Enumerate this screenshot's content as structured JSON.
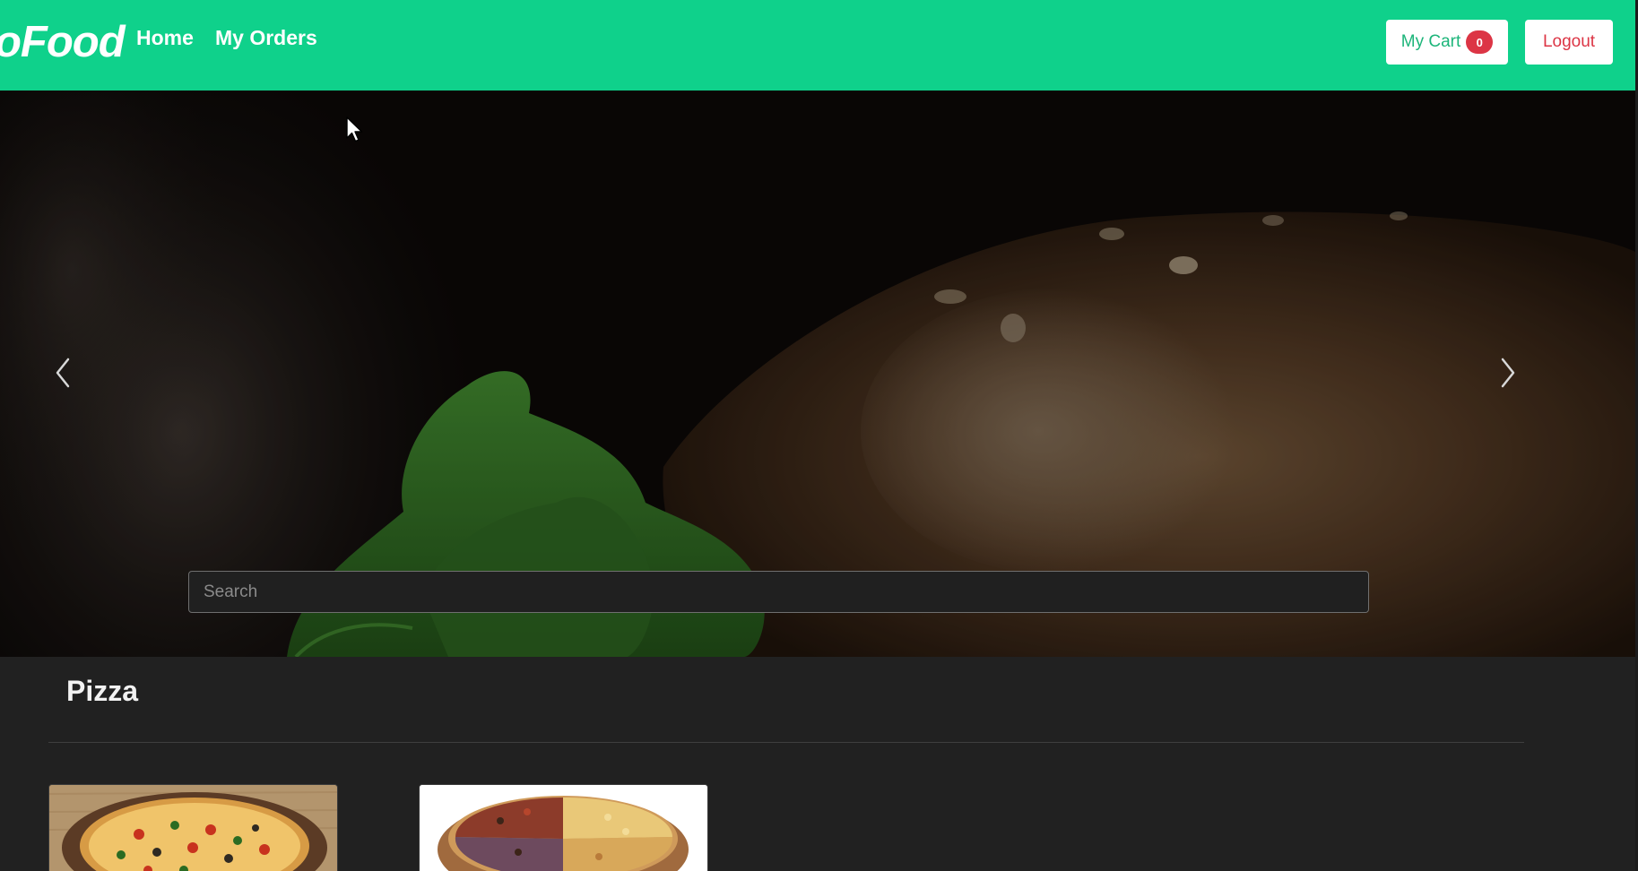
{
  "navbar": {
    "brand": "oFood",
    "links": [
      {
        "label": "Home"
      },
      {
        "label": "My Orders"
      }
    ],
    "cart_label": "My Cart",
    "cart_count": "0",
    "logout_label": "Logout",
    "accent_color": "#0fd18b"
  },
  "hero": {
    "search": {
      "placeholder": "Search",
      "value": ""
    },
    "prev_icon": "chevron-left-icon",
    "next_icon": "chevron-right-icon"
  },
  "category": {
    "title": "Pizza",
    "items": [
      {
        "image": "pizza-image"
      },
      {
        "image": "pizza-image"
      }
    ]
  }
}
